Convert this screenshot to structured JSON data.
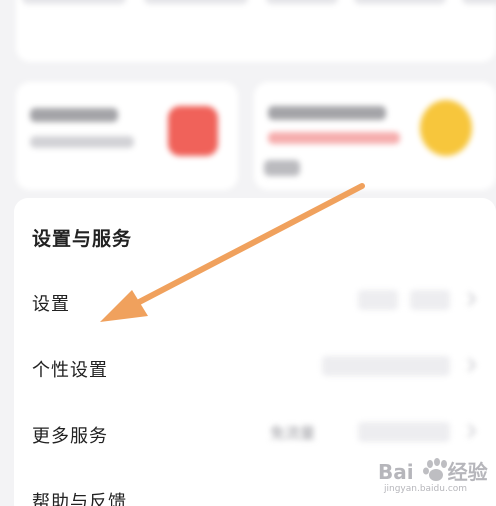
{
  "settings_section": {
    "title": "设置与服务",
    "rows": [
      {
        "label": "设置"
      },
      {
        "label": "个性设置"
      },
      {
        "label": "更多服务",
        "badge": "免流量"
      },
      {
        "label": "帮助与反馈"
      }
    ]
  },
  "watermark": {
    "text": "Bai",
    "text2": "经验",
    "sub": "jingyan.baidu.com"
  },
  "colors": {
    "annotation_arrow": "#f0a15d",
    "promo_red": "#f0625a",
    "promo_yellow": "#f7c63c"
  }
}
